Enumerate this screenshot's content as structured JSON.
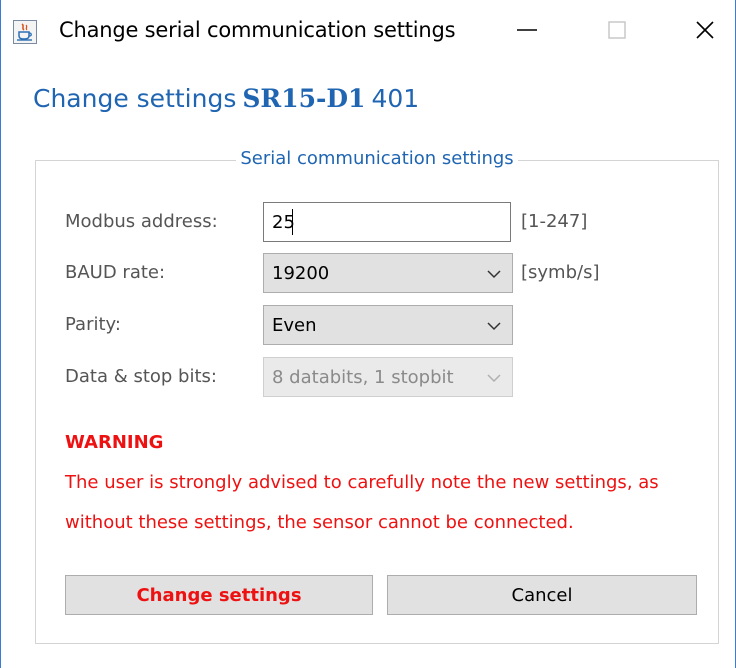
{
  "window": {
    "title": "Change serial communication settings"
  },
  "heading": {
    "prefix": "Change settings",
    "model": "SR15-D1",
    "number": "401"
  },
  "group": {
    "legend": "Serial communication settings",
    "fields": {
      "modbus": {
        "label": "Modbus address:",
        "value": "25",
        "unit": "[1-247]"
      },
      "baud": {
        "label": "BAUD rate:",
        "value": "19200",
        "unit": "[symb/s]"
      },
      "parity": {
        "label": "Parity:",
        "value": "Even"
      },
      "databits": {
        "label": "Data & stop bits:",
        "value": "8 databits, 1 stopbit"
      }
    },
    "warning": {
      "title": "WARNING",
      "line1": "The user is strongly advised to carefully note the new settings, as",
      "line2": "without these settings, the sensor cannot be connected."
    },
    "buttons": {
      "change": "Change settings",
      "cancel": "Cancel"
    }
  },
  "colors": {
    "accent": "#1f65b2",
    "warning": "#ee1111"
  }
}
